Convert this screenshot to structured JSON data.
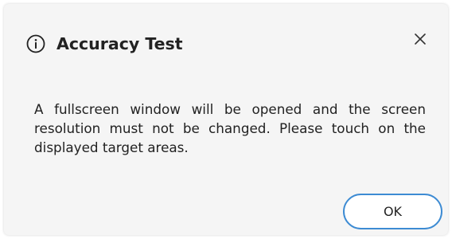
{
  "dialog": {
    "title": "Accuracy Test",
    "message": "A fullscreen window will be opened and the screen resolution must not be changed. Please touch on the displayed target areas.",
    "icons": {
      "info": "info-icon",
      "close": "close-icon"
    },
    "buttons": {
      "ok_label": "OK"
    },
    "colors": {
      "accent": "#3d8bd3",
      "background": "#f5f5f5",
      "text": "#222222"
    }
  }
}
